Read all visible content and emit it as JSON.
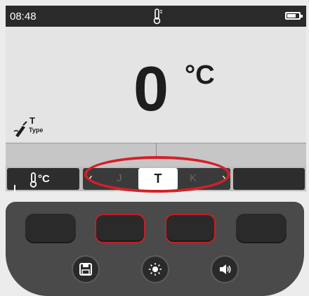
{
  "status": {
    "time": "08:48"
  },
  "reading": {
    "value": "0",
    "unit": "°C"
  },
  "probe": {
    "type": "T",
    "type_label": "Type"
  },
  "softkeys": {
    "unit_label": "°C",
    "selector": {
      "prev": "J",
      "current": "T",
      "next": "K"
    }
  },
  "colors": {
    "highlight": "#d61f26",
    "screen_bg": "#e4e4e4",
    "status_bg": "#2a2a2a"
  },
  "icons": [
    "thermometer-icon",
    "battery-icon",
    "probe-icon",
    "save-icon",
    "brightness-icon",
    "volume-icon"
  ]
}
